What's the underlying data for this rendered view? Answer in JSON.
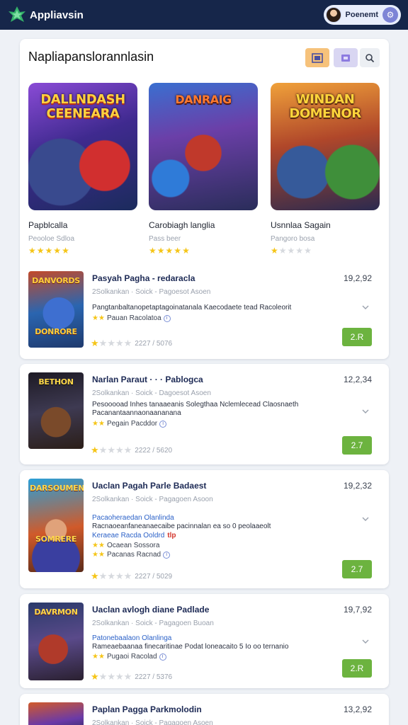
{
  "app": {
    "name": "Appliavsin",
    "user_name": "Poenemt"
  },
  "panel": {
    "title": "Napliapanslorannlasin"
  },
  "featured": [
    {
      "art_title": "DALLNDASH\nCEENEARA",
      "name": "Papblcalla",
      "sub": "Peooloe Sdloa",
      "rating": 5
    },
    {
      "art_title": "DANRAIG",
      "name": "Carobiagh langlia",
      "sub": "Pass beer",
      "rating": 5
    },
    {
      "art_title": "WINDAN\nDOMENOR",
      "name": "Usnnlaa Sagain",
      "sub": "Pangoro bosa",
      "rating": 1
    }
  ],
  "list": [
    {
      "art_title": "DANVORDS\n\n\n\n\n\nDONRORE",
      "title": "Pasyah Pagha - redaracla",
      "price": "19,2,92",
      "meta": "2Solkankan  ·  Soick  -  Pagoesot Asoen",
      "desc": "Pangtanbaltanopetaptagoinatanala Kaecodaete tead Racoleorit",
      "desc2": "",
      "link": "",
      "flag": "",
      "flag_red": "",
      "mini_label": "Pauan Racolatoa",
      "rating_text": "2227 / 5076",
      "rating": 1,
      "button": "2.R"
    },
    {
      "art_title": "BETHON\n\n\n\n\n\n",
      "title": "Narlan Paraut · · · Pablogca",
      "price": "12,2,34",
      "meta": "2Solkankan  ·  Soick  -  Dagoesot Asoen",
      "desc": "Pesooooad Inhes tanaaeanis Solegthaa Nclemlecead Claosnaeth",
      "desc2": "Pacanantaannaonaananana",
      "link": "",
      "flag": "",
      "flag_red": "",
      "mini_label": "Pegain Pacddor",
      "rating_text": "2222 / 5620",
      "rating": 1,
      "button": "2.7"
    },
    {
      "art_title": "DARSOUMEN\n\n\n\n\n\nSOMRERE",
      "title": "Uaclan Pagah Parle Badaest",
      "price": "19,2,32",
      "meta": "2Solkankan  ·  Soick  -  Pagagoen Asoon",
      "desc": "",
      "desc2": "Racnaoeanfaneanaecaibe pacinnalan ea so 0 peolaaeolt",
      "link": "Pacaoheraedan Olanlinda",
      "flag": "Keraeae Racda Ooldrd",
      "flag_red": "tlp",
      "mini_label": "Ocaean Sossora",
      "mini_label2": "Pacanas Racnad",
      "rating_text": "2227 / 5029",
      "rating": 1,
      "button": "2.7"
    },
    {
      "art_title": "DAVRMON\n\n\n\n\n\n",
      "title": "Uaclan avlogh diane Padlade",
      "price": "19,7,92",
      "meta": "2Solkankan  ·  Soick  -  Pagagoen Buoan",
      "desc": "",
      "desc2": "Rameaebaanaa finecaritinae Podat loneacaito 5 Io oo ternanio",
      "link": "Patonebaalaon Olanlinga",
      "flag": "",
      "flag_red": "",
      "mini_label": "Pugaoi Racolad",
      "rating_text": "2227 / 5376",
      "rating": 1,
      "button": "2.R"
    },
    {
      "art_title": "",
      "title": "Paplan Pagga Parkmolodin",
      "price": "13,2,92",
      "meta": "2Solkankan  ·  Soick  -  Pagagoen Asoen",
      "desc": "",
      "desc2": "",
      "link": "",
      "flag": "",
      "flag_red": "",
      "mini_label": "",
      "rating_text": "",
      "rating": 0,
      "button": ""
    }
  ],
  "colors": {
    "topbar": "#16264a",
    "accent_button": "#6cb33f",
    "star": "#f5c518",
    "link": "#2c62c8"
  },
  "icons": [
    "leaf-logo-icon",
    "grid-view-icon",
    "list-view-icon",
    "search-icon",
    "chevron-down-icon",
    "info-icon",
    "settings-icon"
  ]
}
